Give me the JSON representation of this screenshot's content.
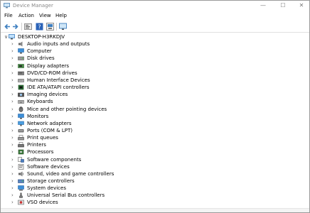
{
  "window": {
    "title": "Device Manager",
    "controls": {
      "minimize": "—",
      "maximize": "☐",
      "close": "✕"
    }
  },
  "menu": {
    "file": "File",
    "action": "Action",
    "view": "View",
    "help": "Help"
  },
  "toolbar": [
    "back-icon",
    "forward-icon",
    "properties-icon",
    "help-icon",
    "update-driver-icon",
    "monitor-icon"
  ],
  "tree": {
    "root": {
      "label": "DESKTOP-H3RKDJV",
      "expanded": true
    },
    "categories": [
      {
        "label": "Audio inputs and outputs",
        "icon": "speaker-icon"
      },
      {
        "label": "Computer",
        "icon": "computer-icon"
      },
      {
        "label": "Disk drives",
        "icon": "disk-icon"
      },
      {
        "label": "Display adapters",
        "icon": "display-adapter-icon"
      },
      {
        "label": "DVD/CD-ROM drives",
        "icon": "dvd-icon"
      },
      {
        "label": "Human Interface Devices",
        "icon": "hid-icon"
      },
      {
        "label": "IDE ATA/ATAPI controllers",
        "icon": "ide-icon"
      },
      {
        "label": "Imaging devices",
        "icon": "camera-icon"
      },
      {
        "label": "Keyboards",
        "icon": "keyboard-icon"
      },
      {
        "label": "Mice and other pointing devices",
        "icon": "mouse-icon"
      },
      {
        "label": "Monitors",
        "icon": "monitor-icon"
      },
      {
        "label": "Network adapters",
        "icon": "network-icon"
      },
      {
        "label": "Ports (COM & LPT)",
        "icon": "port-icon"
      },
      {
        "label": "Print queues",
        "icon": "print-queue-icon"
      },
      {
        "label": "Printers",
        "icon": "printer-icon"
      },
      {
        "label": "Processors",
        "icon": "processor-icon"
      },
      {
        "label": "Software components",
        "icon": "software-component-icon"
      },
      {
        "label": "Software devices",
        "icon": "software-device-icon"
      },
      {
        "label": "Sound, video and game controllers",
        "icon": "sound-icon"
      },
      {
        "label": "Storage controllers",
        "icon": "storage-icon"
      },
      {
        "label": "System devices",
        "icon": "system-icon"
      },
      {
        "label": "Universal Serial Bus controllers",
        "icon": "usb-icon"
      },
      {
        "label": "VSO devices",
        "icon": "vso-icon"
      }
    ]
  },
  "colors": {
    "accent": "#1e7fd2",
    "chevron": "#555555"
  }
}
